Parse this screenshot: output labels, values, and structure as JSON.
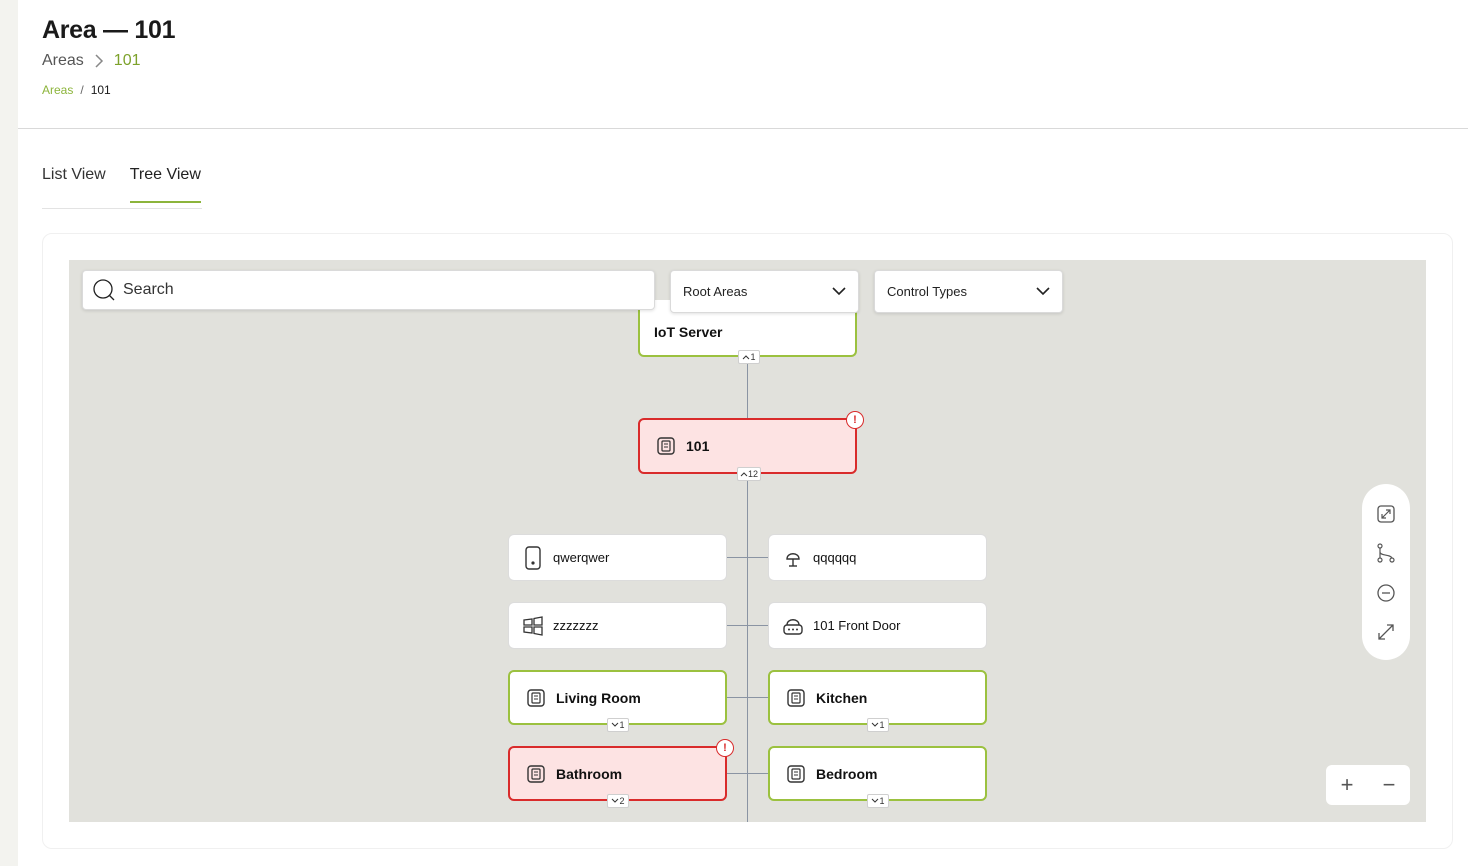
{
  "page": {
    "title": "Area — 101"
  },
  "subtitle_breadcrumb": {
    "parent": "Areas",
    "current": "101"
  },
  "breadcrumb": {
    "parent": "Areas",
    "separator": "/",
    "current": "101"
  },
  "tabs": [
    {
      "label": "List View",
      "active": false
    },
    {
      "label": "Tree View",
      "active": true
    }
  ],
  "toolbar": {
    "search_placeholder": "Search",
    "root_areas": "Root Areas",
    "control_types": "Control Types"
  },
  "tree": {
    "server": {
      "label": "IoT Server",
      "count": "1",
      "icon": "server-icon"
    },
    "area101": {
      "label": "101",
      "count": "12",
      "status": "error",
      "error_mark": "!",
      "icon": "area-icon"
    },
    "children": [
      {
        "label": "qwerqwer",
        "icon": "tablet-icon"
      },
      {
        "label": "qqqqqq",
        "icon": "lamp-icon"
      },
      {
        "label": "zzzzzzz",
        "icon": "windows-icon"
      },
      {
        "label": "101 Front Door",
        "icon": "router-icon"
      },
      {
        "label": "Living Room",
        "count": "1",
        "icon": "area-icon"
      },
      {
        "label": "Kitchen",
        "count": "1",
        "icon": "area-icon"
      },
      {
        "label": "Bathroom",
        "count": "2",
        "status": "error",
        "error_mark": "!",
        "icon": "area-icon"
      },
      {
        "label": "Bedroom",
        "count": "1",
        "icon": "area-icon"
      }
    ]
  },
  "canvas_controls": [
    "fit-view-icon",
    "hierarchy-icon",
    "collapse-icon",
    "fullscreen-icon"
  ],
  "zoom": {
    "in": "+",
    "out": "−"
  },
  "colors": {
    "accent": "#8cb43b",
    "error": "#d92b2b",
    "error_bg": "#fde3e3",
    "canvas": "#e1e1dc"
  }
}
